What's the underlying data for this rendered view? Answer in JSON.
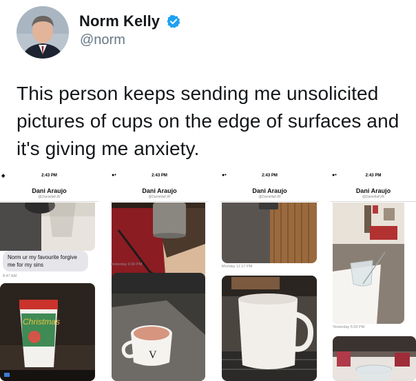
{
  "tweet": {
    "author_name": "Norm Kelly",
    "author_handle": "@norm",
    "verified": true,
    "verified_color": "#1da1f2",
    "text": "This person keeps sending me unsolicited pictures of cups on the edge of surfaces and it's giving me anxiety."
  },
  "screenshots": [
    {
      "time": "2:43 PM",
      "contact_name": "Dani Araujo",
      "contact_handle": "@DaniellaFJR",
      "message": "Norm ur my favourite forgive me for my sins",
      "message_time": "8:47 AM",
      "photo_top_label": "",
      "cup_text": "Christmas"
    },
    {
      "time": "2:43 PM",
      "contact_name": "Dani Araujo",
      "contact_handle": "@DaniellaFJR",
      "timestamp": "Yesterday 9:30 PM"
    },
    {
      "time": "2:43 PM",
      "contact_name": "Dani Araujo",
      "contact_handle": "@DaniellaFJR",
      "timestamp": "Monday 11:17 PM"
    },
    {
      "time": "2:43 PM",
      "contact_name": "Dani Araujo",
      "contact_handle": "@DaniellaFJR",
      "timestamp": "Yesterday 5:03 PM"
    }
  ]
}
